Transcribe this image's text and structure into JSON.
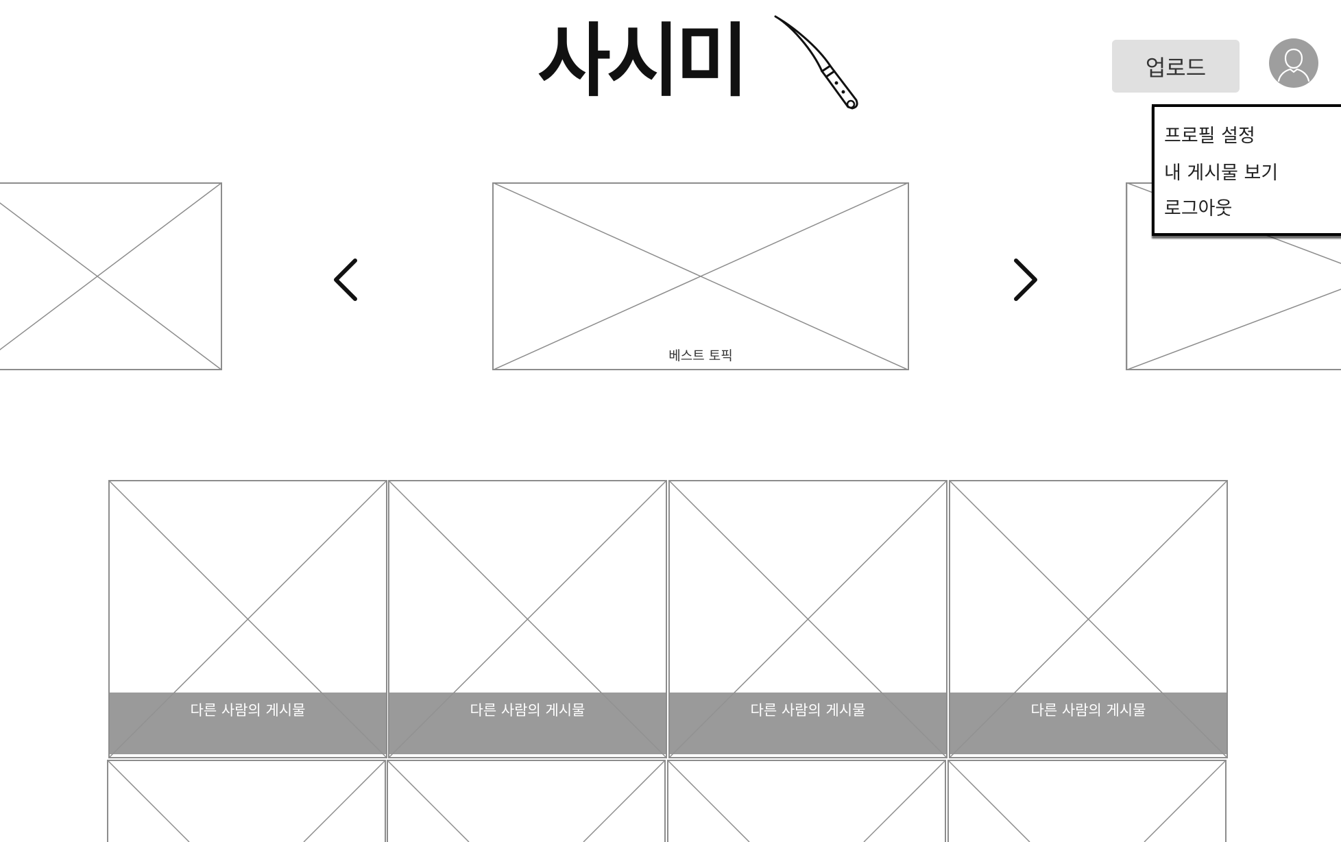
{
  "header": {
    "logo_text": "사시미",
    "upload_label": "업로드"
  },
  "profile_menu": {
    "items": [
      {
        "label": "프로필 설정"
      },
      {
        "label": "내 게시물 보기"
      },
      {
        "label": "로그아웃"
      }
    ]
  },
  "carousel": {
    "center_label": "베스트 토픽"
  },
  "posts": {
    "items": [
      {
        "caption": "다른 사람의 게시물"
      },
      {
        "caption": "다른 사람의 게시물"
      },
      {
        "caption": "다른 사람의 게시물"
      },
      {
        "caption": "다른 사람의 게시물"
      }
    ]
  },
  "icons": {
    "logo": "knife-icon",
    "avatar": "user-icon",
    "prev": "chevron-left-icon",
    "next": "chevron-right-icon"
  },
  "colors": {
    "upload_bg": "#e0e0e0",
    "avatar_bg": "#9e9e9e",
    "caption_bg": "#919191",
    "placeholder_stroke": "#8c8c8c"
  }
}
